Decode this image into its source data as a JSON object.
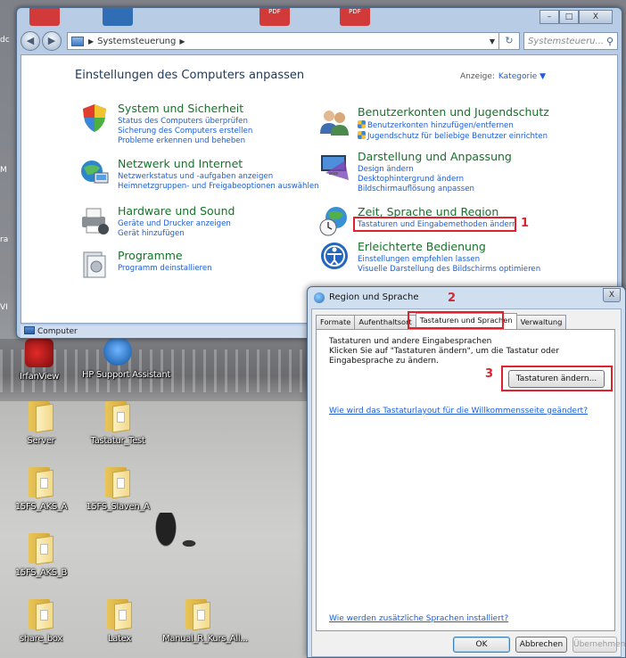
{
  "desktop": {
    "edge_labels": [
      "dc",
      "M",
      "ra",
      "VI"
    ],
    "icons": [
      {
        "label": "IrfanView",
        "type": "app",
        "color": "#c4161c"
      },
      {
        "label": "HP Support Assistant",
        "type": "app",
        "color": "#1a73c7"
      },
      {
        "label": "Server",
        "type": "folder"
      },
      {
        "label": "Tastatur_Test",
        "type": "folder-doc"
      },
      {
        "label": "15FS_AKS_A",
        "type": "folder-doc"
      },
      {
        "label": "15FS_Slaven_A",
        "type": "folder-doc"
      },
      {
        "label": "15FS_AKS_B",
        "type": "folder-doc"
      },
      {
        "label": "share_box",
        "type": "folder-doc"
      },
      {
        "label": "Latex",
        "type": "folder-doc"
      },
      {
        "label": "Manual_R_Kurs_All...",
        "type": "folder-doc"
      }
    ]
  },
  "control_panel": {
    "title_thumbnails": [
      {
        "color": "#d23a3a",
        "label": ""
      },
      {
        "color": "#2f6db5",
        "label": ""
      },
      {
        "color": "#d23a3a",
        "label": "PDF"
      },
      {
        "color": "#d23a3a",
        "label": "PDF"
      }
    ],
    "caption_buttons": {
      "minimize": "–",
      "maximize": "□",
      "close": "X"
    },
    "nav": {
      "back": "◀",
      "forward": "▶"
    },
    "address": {
      "path": "Systemsteuerung",
      "separator": "▶",
      "dropdown": "▼",
      "refresh": "↻"
    },
    "search": {
      "placeholder": "Systemsteueru...",
      "icon": "search-icon"
    },
    "heading": "Einstellungen des Computers anpassen",
    "view_by": {
      "label": "Anzeige:",
      "value": "Kategorie ▼"
    },
    "categories": [
      {
        "title": "System und Sicherheit",
        "icon": "shield-icon",
        "links": [
          "Status des Computers überprüfen",
          "Sicherung des Computers erstellen",
          "Probleme erkennen und beheben"
        ]
      },
      {
        "title": "Netzwerk und Internet",
        "icon": "network-icon",
        "links": [
          "Netzwerkstatus und -aufgaben anzeigen",
          "Heimnetzgruppen- und Freigabeoptionen auswählen"
        ]
      },
      {
        "title": "Hardware und Sound",
        "icon": "printer-icon",
        "links": [
          "Geräte und Drucker anzeigen",
          "Gerät hinzufügen"
        ]
      },
      {
        "title": "Programme",
        "icon": "programs-icon",
        "links": [
          "Programm deinstallieren"
        ]
      },
      {
        "title": "Benutzerkonten und Jugendschutz",
        "icon": "users-icon",
        "links": [
          "Benutzerkonten hinzufügen/entfernen",
          "Jugendschutz für beliebige Benutzer einrichten"
        ]
      },
      {
        "title": "Darstellung und Anpassung",
        "icon": "display-icon",
        "links": [
          "Design ändern",
          "Desktophintergrund ändern",
          "Bildschirmauflösung anpassen"
        ]
      },
      {
        "title": "Zeit, Sprache und Region",
        "icon": "globe-clock-icon",
        "links": [
          "Tastaturen und Eingabemethoden ändern"
        ]
      },
      {
        "title": "Erleichterte Bedienung",
        "icon": "accessibility-icon",
        "links": [
          "Einstellungen empfehlen lassen",
          "Visuelle Darstellung des Bildschirms optimieren"
        ]
      }
    ],
    "status_bar": "Computer"
  },
  "annotations": {
    "step1": "1",
    "step2": "2",
    "step3": "3",
    "color": "#e0212e"
  },
  "dialog": {
    "title": "Region und Sprache",
    "close": "X",
    "tabs": [
      "Formate",
      "Aufenthaltsort",
      "Tastaturen und Sprachen",
      "Verwaltung"
    ],
    "active_tab": "Tastaturen und Sprachen",
    "group_title": "Tastaturen und andere Eingabesprachen",
    "group_desc": "Klicken Sie auf \"Tastaturen ändern\", um die Tastatur oder Eingabesprache zu ändern.",
    "change_button": "Tastaturen ändern...",
    "welcome_link": "Wie wird das Tastaturlayout für die Willkommensseite geändert?",
    "more_languages_link": "Wie werden zusätzliche Sprachen installiert?",
    "buttons": {
      "ok": "OK",
      "cancel": "Abbrechen",
      "apply": "Übernehmen"
    }
  },
  "colors": {
    "link": "#1c5dd8",
    "category_title": "#157228",
    "heading": "#1e395b"
  }
}
